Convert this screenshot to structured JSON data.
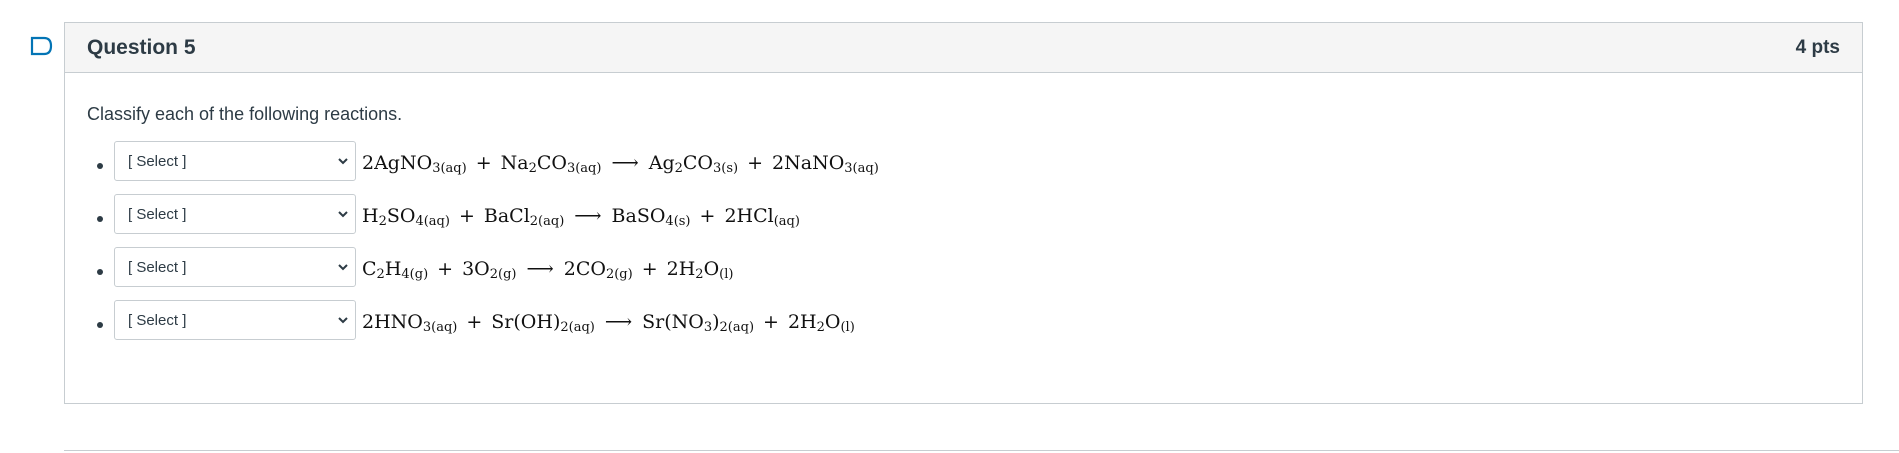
{
  "question": {
    "title": "Question 5",
    "points": "4 pts",
    "prompt": "Classify each of the following reactions."
  },
  "reactions": [
    {
      "select_value": "[ Select ]",
      "terms_left": [
        [
          {
            "t": "2AgNO"
          },
          {
            "s": "3(aq)"
          }
        ],
        [
          {
            "t": "Na"
          },
          {
            "s": "2"
          },
          {
            "t": "CO"
          },
          {
            "s": "3(aq)"
          }
        ]
      ],
      "terms_right": [
        [
          {
            "t": "Ag"
          },
          {
            "s": "2"
          },
          {
            "t": "CO"
          },
          {
            "s": "3(s)"
          }
        ],
        [
          {
            "t": "2NaNO"
          },
          {
            "s": "3(aq)"
          }
        ]
      ]
    },
    {
      "select_value": "[ Select ]",
      "terms_left": [
        [
          {
            "t": "H"
          },
          {
            "s": "2"
          },
          {
            "t": "SO"
          },
          {
            "s": "4(aq)"
          }
        ],
        [
          {
            "t": "BaCl"
          },
          {
            "s": "2(aq)"
          }
        ]
      ],
      "terms_right": [
        [
          {
            "t": "BaSO"
          },
          {
            "s": "4(s)"
          }
        ],
        [
          {
            "t": "2HCl"
          },
          {
            "s": "(aq)"
          }
        ]
      ]
    },
    {
      "select_value": "[ Select ]",
      "terms_left": [
        [
          {
            "t": "C"
          },
          {
            "s": "2"
          },
          {
            "t": "H"
          },
          {
            "s": "4(g)"
          }
        ],
        [
          {
            "t": "3O"
          },
          {
            "s": "2(g)"
          }
        ]
      ],
      "terms_right": [
        [
          {
            "t": "2CO"
          },
          {
            "s": "2(g)"
          }
        ],
        [
          {
            "t": "2H"
          },
          {
            "s": "2"
          },
          {
            "t": "O"
          },
          {
            "s": "(l)"
          }
        ]
      ]
    },
    {
      "select_value": "[ Select ]",
      "terms_left": [
        [
          {
            "t": "2HNO"
          },
          {
            "s": "3(aq)"
          }
        ],
        [
          {
            "t": "Sr(OH)"
          },
          {
            "s": "2(aq)"
          }
        ]
      ],
      "terms_right": [
        [
          {
            "t": "Sr(NO"
          },
          {
            "s": "3"
          },
          {
            "t": ")"
          },
          {
            "s": "2(aq)"
          }
        ],
        [
          {
            "t": "2H"
          },
          {
            "s": "2"
          },
          {
            "t": "O"
          },
          {
            "s": "(l)"
          }
        ]
      ]
    }
  ],
  "symbols": {
    "plus": "+",
    "arrow": "⟶"
  },
  "colors": {
    "flag": "#0374b5",
    "text": "#2d3b45",
    "border": "#c7cdd1",
    "header_bg": "#f5f5f5"
  }
}
